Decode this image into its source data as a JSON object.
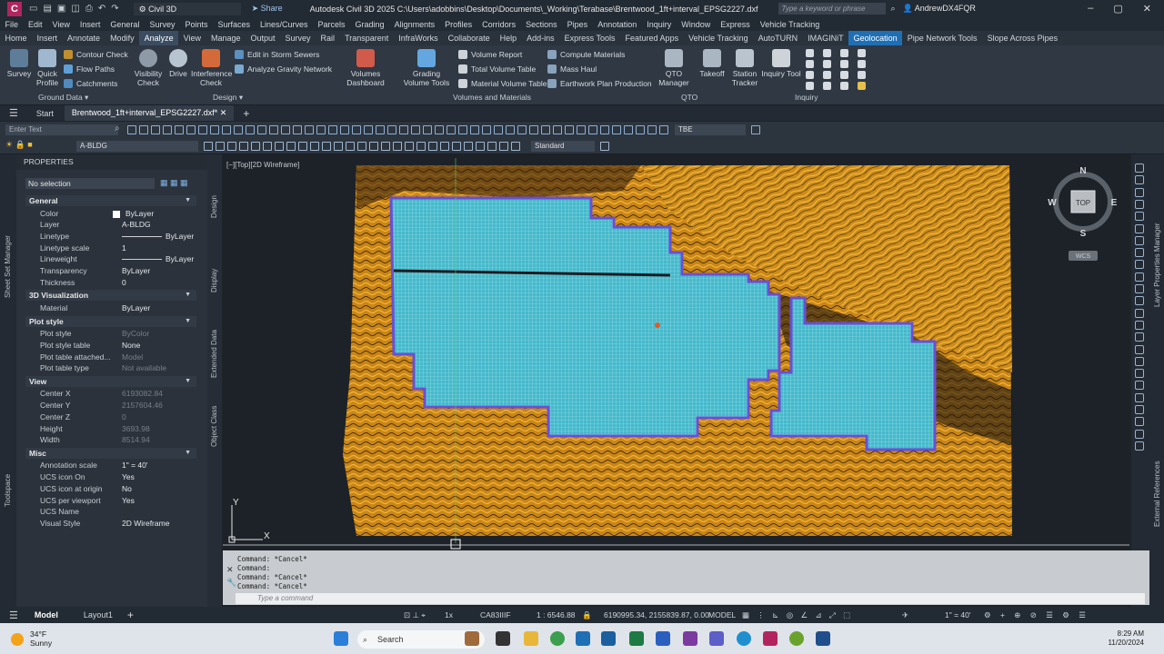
{
  "app": {
    "logo_letter": "C",
    "workspace": "Civil 3D",
    "share": "Share",
    "title": "Autodesk Civil 3D 2025   C:\\Users\\adobbins\\Desktop\\Documents\\_Working\\Terabase\\Brentwood_1ft+interval_EPSG2227.dxf",
    "search_placeholder": "Type a keyword or phrase",
    "user": "AndrewDX4FQR"
  },
  "menubar": [
    "File",
    "Edit",
    "View",
    "Insert",
    "General",
    "Survey",
    "Points",
    "Surfaces",
    "Lines/Curves",
    "Parcels",
    "Grading",
    "Alignments",
    "Profiles",
    "Corridors",
    "Sections",
    "Pipes",
    "Annotation",
    "Inquiry",
    "Window",
    "Express",
    "Vehicle Tracking"
  ],
  "ribbon_tabs": [
    "Home",
    "Insert",
    "Annotate",
    "Modify",
    "Analyze",
    "View",
    "Manage",
    "Output",
    "Survey",
    "Rail",
    "Transparent",
    "InfraWorks",
    "Collaborate",
    "Help",
    "Add-ins",
    "Express Tools",
    "Featured Apps",
    "Vehicle Tracking",
    "AutoTURN",
    "IMAGINiT",
    "Geolocation",
    "Pipe Network Tools",
    "Slope Across Pipes"
  ],
  "ribbon": {
    "ground_data": {
      "title": "Ground Data",
      "survey": "Survey",
      "quick_profile": "Quick Profile",
      "contour_check": "Contour Check",
      "flow_paths": "Flow Paths",
      "catchments": "Catchments"
    },
    "design": {
      "title": "Design",
      "visibility_check": "Visibility Check",
      "drive": "Drive",
      "interference_check": "Interference Check",
      "edit_storm": "Edit in Storm Sewers",
      "gravity": "Analyze Gravity Network"
    },
    "volumes": {
      "title": "Volumes and Materials",
      "dashboard": "Volumes Dashboard",
      "grading_tools": "Grading Volume Tools",
      "volume_report": "Volume Report",
      "total_volume_table": "Total Volume Table",
      "material_volume_table": "Material Volume Table",
      "compute_materials": "Compute Materials",
      "mass_haul": "Mass Haul",
      "earthwork": "Earthwork Plan Production"
    },
    "qto": {
      "title": "QTO",
      "manager": "QTO Manager",
      "takeoff": "Takeoff"
    },
    "inquiry": {
      "title": "Inquiry",
      "station_tracker": "Station Tracker",
      "inquiry_tool": "Inquiry Tool"
    }
  },
  "doc_tabs": {
    "start": "Start",
    "current": "Brentwood_1ft+interval_EPSG2227.dxf*"
  },
  "toolbar": {
    "enter_text_placeholder": "Enter Text",
    "layer": "A-BLDG",
    "text_style": "Standard",
    "tbe": "TBE"
  },
  "properties": {
    "header": "PROPERTIES",
    "selection": "No selection",
    "sections": [
      {
        "title": "General",
        "rows": [
          {
            "k": "Color",
            "v": "ByLayer"
          },
          {
            "k": "Layer",
            "v": "A-BLDG"
          },
          {
            "k": "Linetype",
            "v": "ByLayer"
          },
          {
            "k": "Linetype scale",
            "v": "1"
          },
          {
            "k": "Lineweight",
            "v": "ByLayer"
          },
          {
            "k": "Transparency",
            "v": "ByLayer"
          },
          {
            "k": "Thickness",
            "v": "0"
          }
        ]
      },
      {
        "title": "3D Visualization",
        "rows": [
          {
            "k": "Material",
            "v": "ByLayer"
          }
        ]
      },
      {
        "title": "Plot style",
        "rows": [
          {
            "k": "Plot style",
            "v": "ByColor"
          },
          {
            "k": "Plot style table",
            "v": "None"
          },
          {
            "k": "Plot table attached...",
            "v": "Model"
          },
          {
            "k": "Plot table type",
            "v": "Not available"
          }
        ]
      },
      {
        "title": "View",
        "rows": [
          {
            "k": "Center X",
            "v": "6193082.84"
          },
          {
            "k": "Center Y",
            "v": "2157604.46"
          },
          {
            "k": "Center Z",
            "v": "0"
          },
          {
            "k": "Height",
            "v": "3693.98"
          },
          {
            "k": "Width",
            "v": "8514.94"
          }
        ]
      },
      {
        "title": "Misc",
        "rows": [
          {
            "k": "Annotation scale",
            "v": "1\" = 40'"
          },
          {
            "k": "UCS icon On",
            "v": "Yes"
          },
          {
            "k": "UCS icon at origin",
            "v": "No"
          },
          {
            "k": "UCS per viewport",
            "v": "Yes"
          },
          {
            "k": "UCS Name",
            "v": ""
          },
          {
            "k": "Visual Style",
            "v": "2D Wireframe"
          }
        ]
      }
    ],
    "side_tabs": [
      "Design",
      "Display",
      "Extended Data",
      "Object Class"
    ],
    "left_tabs": [
      "Sheet Set Manager",
      "Toolspace"
    ]
  },
  "viewport": {
    "label": "[−][Top][2D Wireframe]",
    "compass": {
      "n": "N",
      "s": "S",
      "e": "E",
      "w": "W",
      "top": "TOP",
      "wcs": "WCS"
    },
    "ucs_x": "X",
    "ucs_y": "Y"
  },
  "right_tabs": [
    "Layer Properties Manager",
    "External References"
  ],
  "command": {
    "lines": [
      "Command: *Cancel*",
      "Command:",
      "Command: *Cancel*",
      "Command: *Cancel*"
    ],
    "placeholder": "Type a command"
  },
  "status": {
    "model": "Model",
    "layout": "Layout1",
    "scale_x": "1x",
    "coord_system": "CA83IIIF",
    "ratio": "1 : 6546.88",
    "coords": "6190995.34, 2155839.87, 0.00",
    "model_label": "MODEL",
    "anno_scale": "1\" = 40'"
  },
  "taskbar": {
    "temp": "34°F",
    "weather": "Sunny",
    "search": "Search",
    "time": "8:29 AM",
    "date": "11/20/2024"
  },
  "colors": {
    "contours": "#e8a21b",
    "building_fill": "#3fb7c9",
    "building_edge": "#6a4fd6",
    "accent": "#1f6fb5"
  }
}
